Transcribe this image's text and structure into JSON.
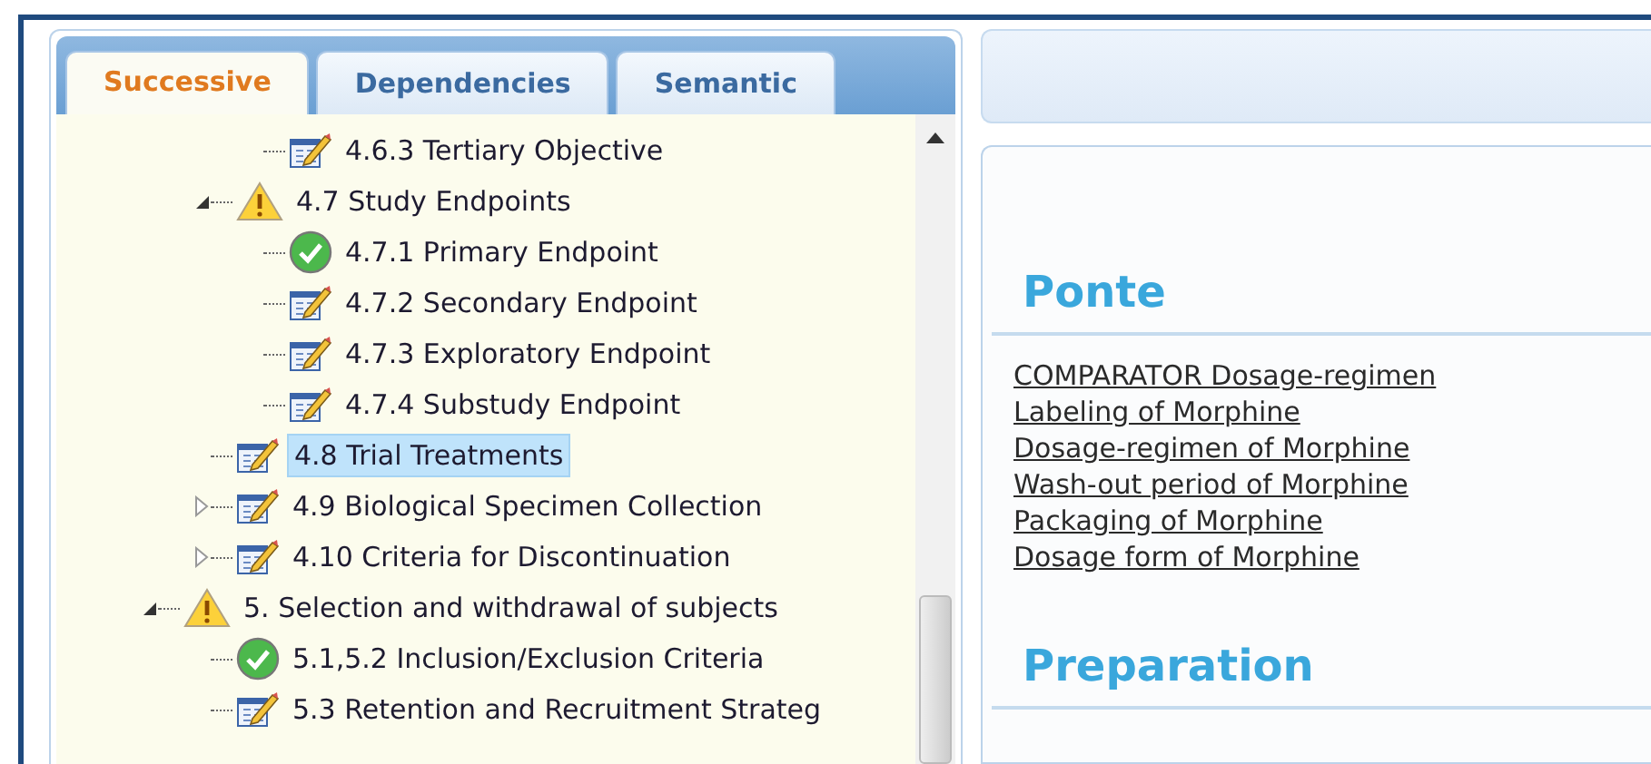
{
  "tabs": [
    {
      "label": "Successive",
      "selected": true
    },
    {
      "label": "Dependencies",
      "selected": false
    },
    {
      "label": "Semantic",
      "selected": false
    }
  ],
  "tree": [
    {
      "children": [
        {
          "children": [
            {
              "label": "4.6.3 Tertiary Objective",
              "kind": "edit",
              "selected": false
            }
          ]
        },
        {
          "label": "4.7 Study Endpoints",
          "kind": "warning",
          "expanded": true,
          "selected": false,
          "children": [
            {
              "label": "4.7.1 Primary Endpoint",
              "kind": "check",
              "selected": false
            },
            {
              "label": "4.7.2 Secondary Endpoint",
              "kind": "edit",
              "selected": false
            },
            {
              "label": "4.7.3 Exploratory Endpoint",
              "kind": "edit",
              "selected": false
            },
            {
              "label": "4.7.4 Substudy Endpoint",
              "kind": "edit",
              "selected": false
            }
          ]
        },
        {
          "label": "4.8 Trial Treatments",
          "kind": "edit",
          "selected": true
        },
        {
          "label": "4.9 Biological Specimen Collection",
          "kind": "edit",
          "expanded": false,
          "selected": false
        },
        {
          "label": "4.10 Criteria for Discontinuation",
          "kind": "edit",
          "expanded": false,
          "selected": false
        }
      ]
    },
    {
      "label": "5. Selection and withdrawal of subjects",
      "kind": "warning",
      "expanded": true,
      "selected": false,
      "children": [
        {
          "label": "5.1,5.2 Inclusion/Exclusion Criteria",
          "kind": "check",
          "selected": false
        },
        {
          "label": "5.3 Retention and Recruitment Strateg",
          "kind": "edit",
          "selected": false
        }
      ]
    }
  ],
  "sections": [
    {
      "heading": "Ponte",
      "links": [
        "COMPARATOR Dosage-regimen",
        "Labeling of Morphine",
        "Dosage-regimen of Morphine",
        "Wash-out period of Morphine",
        "Packaging of Morphine",
        "Dosage form of Morphine"
      ]
    },
    {
      "heading": "Preparation"
    }
  ]
}
